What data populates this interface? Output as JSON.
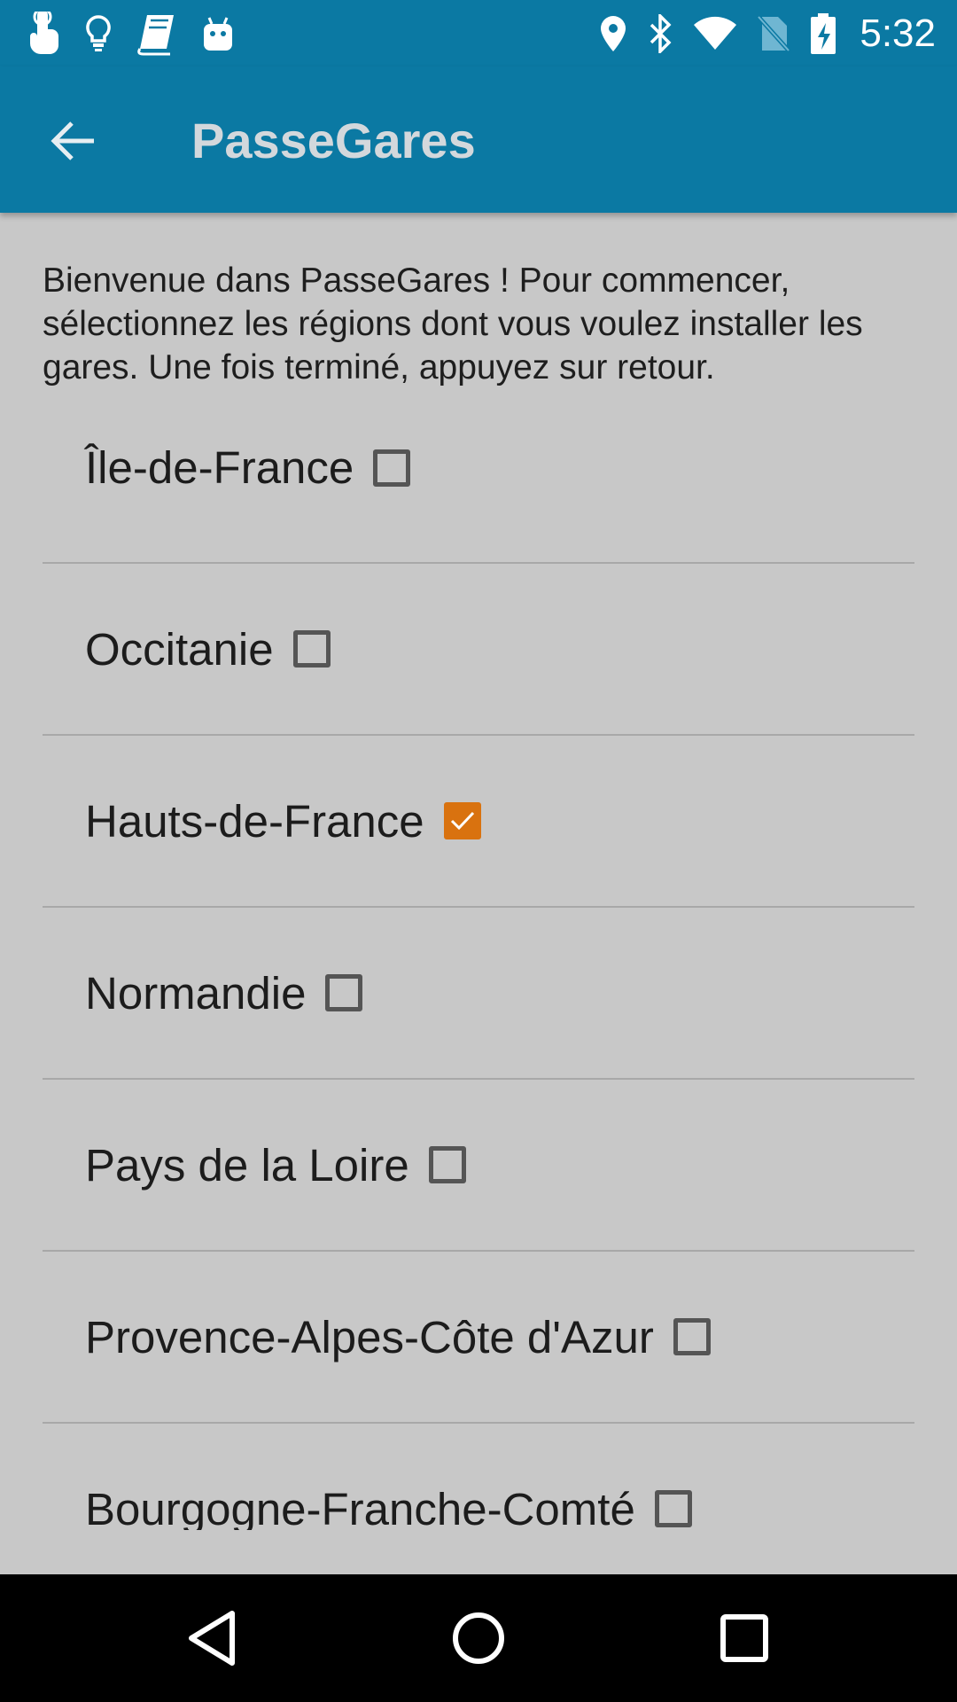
{
  "status_bar": {
    "time": "5:32",
    "left_icons": [
      "touch-icon",
      "lightbulb-icon",
      "notebook-icon",
      "android-icon"
    ],
    "right_icons": [
      "location-icon",
      "bluetooth-icon",
      "wifi-icon",
      "no-sim-icon",
      "battery-charging-icon"
    ]
  },
  "app_bar": {
    "title": "PasseGares",
    "back_icon": "arrow-back-icon"
  },
  "intro_text": "Bienvenue dans PasseGares ! Pour commencer, sélectionnez les régions dont vous voulez installer les gares. Une fois terminé, appuyez sur retour.",
  "regions": [
    {
      "label": "Île-de-France",
      "checked": false
    },
    {
      "label": "Occitanie",
      "checked": false
    },
    {
      "label": "Hauts-de-France",
      "checked": true
    },
    {
      "label": "Normandie",
      "checked": false
    },
    {
      "label": "Pays de la Loire",
      "checked": false
    },
    {
      "label": "Provence-Alpes-Côte d'Azur",
      "checked": false
    },
    {
      "label": "Bourgogne-Franche-Comté",
      "checked": false
    }
  ],
  "colors": {
    "primary": "#0b79a3",
    "background": "#c8c8c8",
    "checkbox_checked": "#d9720f",
    "nav_bar": "#000000"
  },
  "nav_bar": {
    "buttons": [
      "back-triangle-icon",
      "home-circle-icon",
      "recents-square-icon"
    ]
  }
}
